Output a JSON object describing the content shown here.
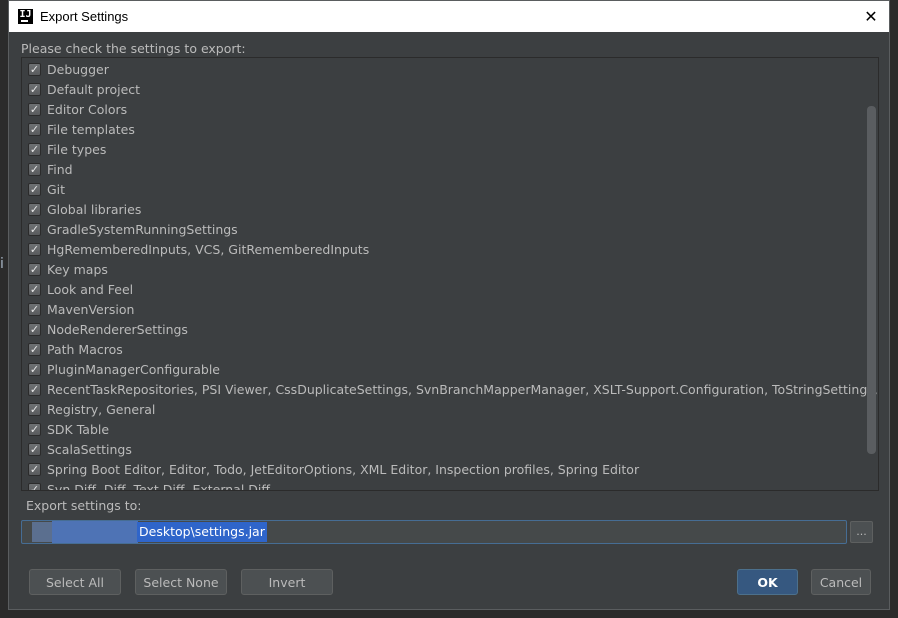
{
  "window": {
    "title": "Export Settings",
    "close_glyph": "✕"
  },
  "prompt": "Please check the settings to export:",
  "items": [
    {
      "label": "Debugger",
      "checked": true
    },
    {
      "label": "Default project",
      "checked": true
    },
    {
      "label": "Editor Colors",
      "checked": true
    },
    {
      "label": "File templates",
      "checked": true
    },
    {
      "label": "File types",
      "checked": true
    },
    {
      "label": "Find",
      "checked": true
    },
    {
      "label": "Git",
      "checked": true
    },
    {
      "label": "Global libraries",
      "checked": true
    },
    {
      "label": "GradleSystemRunningSettings",
      "checked": true
    },
    {
      "label": "HgRememberedInputs, VCS, GitRememberedInputs",
      "checked": true
    },
    {
      "label": "Key maps",
      "checked": true
    },
    {
      "label": "Look and Feel",
      "checked": true
    },
    {
      "label": "MavenVersion",
      "checked": true
    },
    {
      "label": "NodeRendererSettings",
      "checked": true
    },
    {
      "label": "Path Macros",
      "checked": true
    },
    {
      "label": "PluginManagerConfigurable",
      "checked": true
    },
    {
      "label": "RecentTaskRepositories, PSI Viewer, CssDuplicateSettings, SvnBranchMapperManager, XSLT-Support.Configuration, ToStringSettings, Play...",
      "checked": true
    },
    {
      "label": "Registry, General",
      "checked": true
    },
    {
      "label": "SDK Table",
      "checked": true
    },
    {
      "label": "ScalaSettings",
      "checked": true
    },
    {
      "label": "Spring Boot Editor, Editor, Todo, JetEditorOptions, XML Editor, Inspection profiles, Spring Editor",
      "checked": true
    },
    {
      "label": "Svn Diff, Diff, Text Diff, External Diff",
      "checked": true
    }
  ],
  "export": {
    "label": "Export settings to:",
    "path": "Desktop\\settings.jar",
    "browse_label": "..."
  },
  "buttons": {
    "select_all": "Select All",
    "select_none": "Select None",
    "invert": "Invert",
    "ok": "OK",
    "cancel": "Cancel"
  },
  "colors": {
    "dialog_bg": "#3c3f41",
    "selection": "#2f65ca",
    "ok_button": "#365880"
  }
}
